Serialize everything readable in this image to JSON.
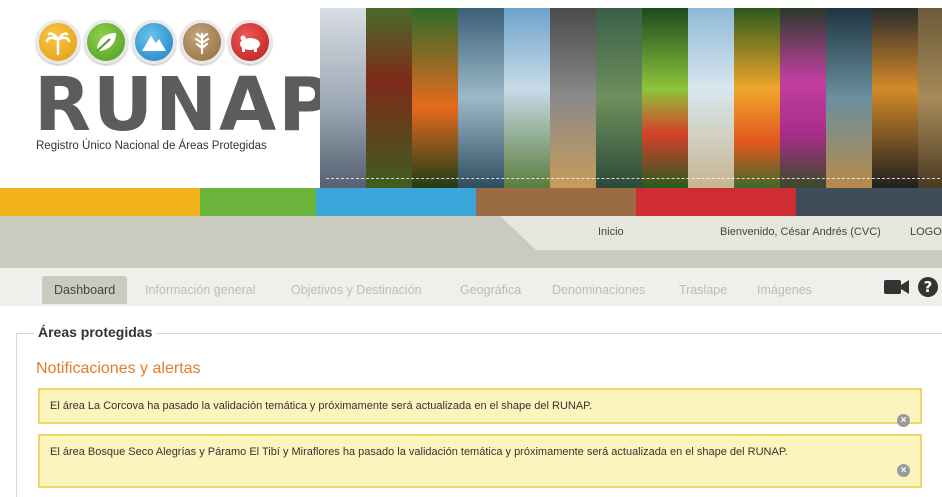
{
  "header": {
    "brand": "RUNAP",
    "subtitle": "Registro Único Nacional de Áreas Protegidas",
    "icons": [
      "palm-tree-icon",
      "leaf-icon",
      "mountain-icon",
      "wheat-icon",
      "bear-icon"
    ]
  },
  "colors": {
    "colorbar": [
      "#f2b31c",
      "#6bb43b",
      "#3aa6d9",
      "#9b6b43",
      "#cf2d33",
      "#3f4d5a"
    ],
    "accent_orange": "#e27d2c",
    "alert_bg": "#fcf4bd"
  },
  "usernav": {
    "home": "Inicio",
    "welcome": "Bienvenido, César Andrés (CVC)",
    "logout": "LOGOU"
  },
  "tabs": [
    {
      "label": "Dashboard",
      "active": true
    },
    {
      "label": "Información general",
      "active": false
    },
    {
      "label": "Objetivos y Destinación",
      "active": false
    },
    {
      "label": "Geográfica",
      "active": false
    },
    {
      "label": "Denominaciones",
      "active": false
    },
    {
      "label": "Traslape",
      "active": false
    },
    {
      "label": "Imágenes",
      "active": false
    }
  ],
  "main": {
    "section_title": "Áreas protegidas",
    "notifications_title": "Notificaciones y alertas",
    "alerts": [
      {
        "text": "El área La Corcova ha pasado la validación temática y próximamente será actualizada en el shape del RUNAP."
      },
      {
        "text": "El área Bosque Seco Alegrías y Páramo El Tibí y Miraflores ha pasado la validación temática y próximamente será actualizada en el shape del RUNAP."
      }
    ]
  }
}
